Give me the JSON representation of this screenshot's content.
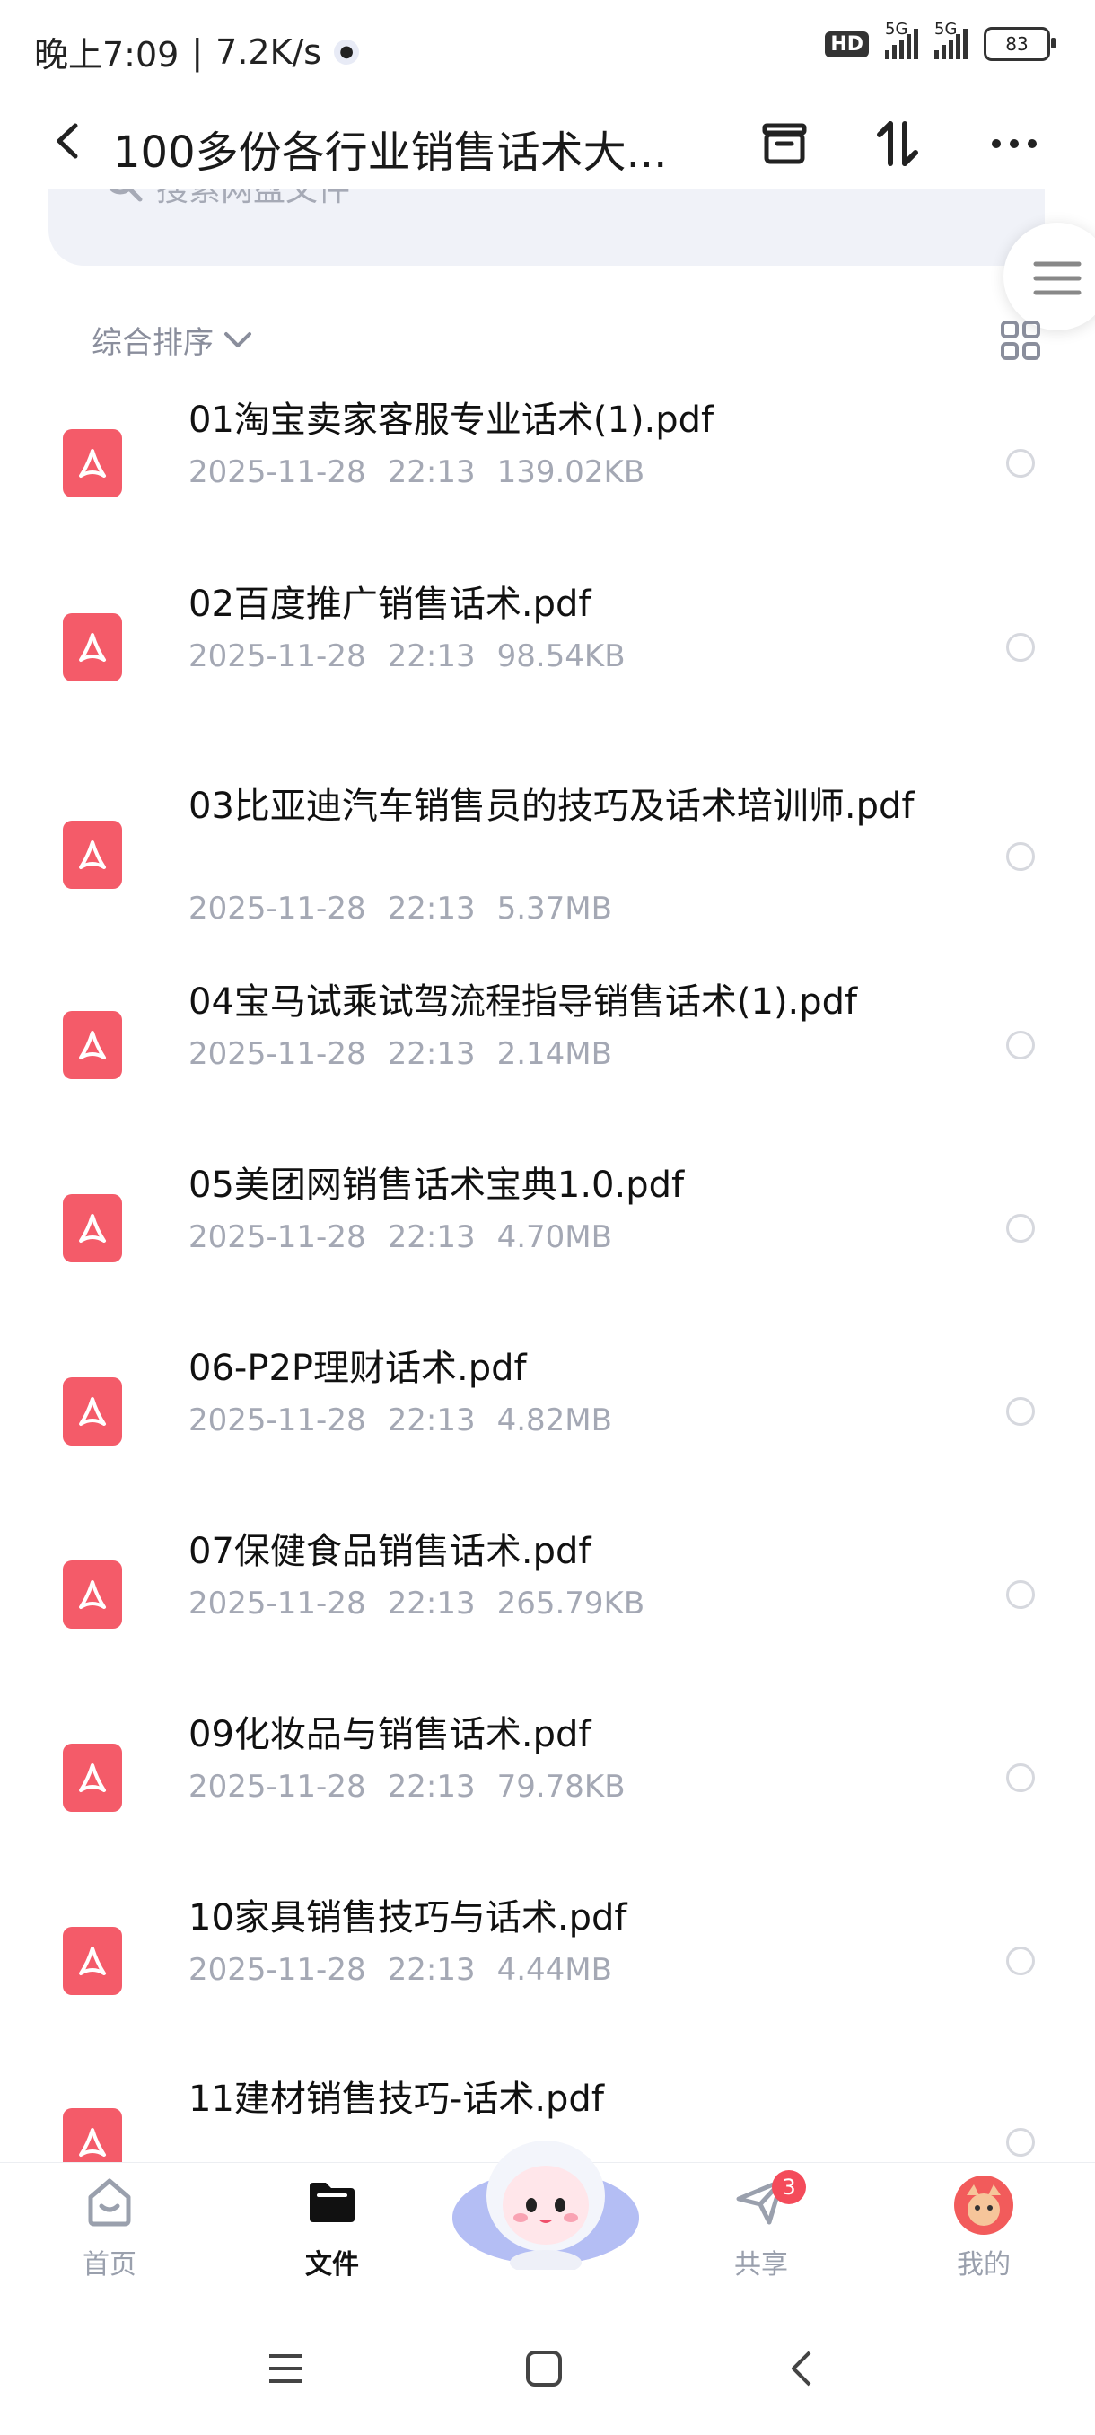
{
  "status_bar": {
    "time": "晚上7:09",
    "speed": "7.2K/s",
    "hd": "HD",
    "network1": "5G",
    "network2": "5G",
    "battery": "83"
  },
  "header": {
    "title": "100多份各行业销售话术大..."
  },
  "search": {
    "placeholder": "搜索网盘文件"
  },
  "sort": {
    "label": "综合排序"
  },
  "files": [
    {
      "name": "01淘宝卖家客服专业话术(1).pdf",
      "date": "2025-11-28",
      "time": "22:13",
      "size": "139.02KB"
    },
    {
      "name": "02百度推广销售话术.pdf",
      "date": "2025-11-28",
      "time": "22:13",
      "size": "98.54KB"
    },
    {
      "name": "03比亚迪汽车销售员的技巧及话术培训师.pdf",
      "date": "2025-11-28",
      "time": "22:13",
      "size": "5.37MB"
    },
    {
      "name": "04宝马试乘试驾流程指导销售话术(1).pdf",
      "date": "2025-11-28",
      "time": "22:13",
      "size": "2.14MB"
    },
    {
      "name": "05美团网销售话术宝典1.0.pdf",
      "date": "2025-11-28",
      "time": "22:13",
      "size": "4.70MB"
    },
    {
      "name": "06-P2P理财话术.pdf",
      "date": "2025-11-28",
      "time": "22:13",
      "size": "4.82MB"
    },
    {
      "name": "07保健食品销售话术.pdf",
      "date": "2025-11-28",
      "time": "22:13",
      "size": "265.79KB"
    },
    {
      "name": "09化妆品与销售话术.pdf",
      "date": "2025-11-28",
      "time": "22:13",
      "size": "79.78KB"
    },
    {
      "name": "10家具销售技巧与话术.pdf",
      "date": "2025-11-28",
      "time": "22:13",
      "size": "4.44MB"
    },
    {
      "name": "11建材销售技巧-话术.pdf",
      "date": "",
      "time": "",
      "size": ""
    }
  ],
  "nav": {
    "home": "首页",
    "files": "文件",
    "share": "共享",
    "share_badge": "3",
    "me": "我的"
  }
}
